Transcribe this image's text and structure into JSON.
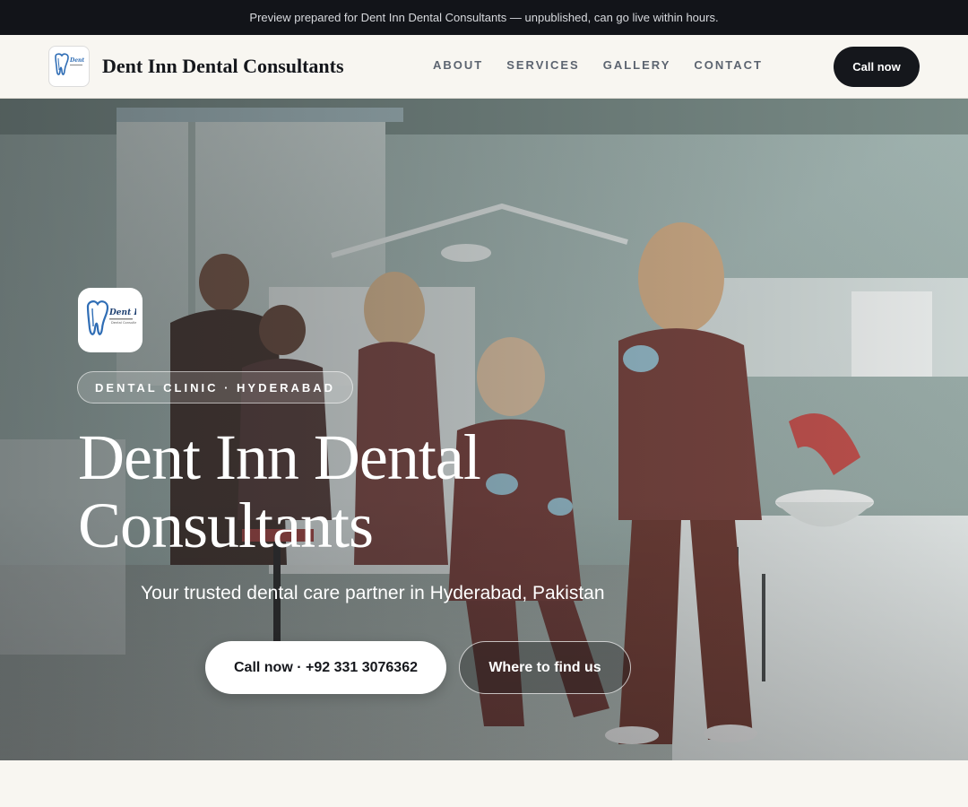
{
  "preview_bar": {
    "text": "Preview prepared for Dent Inn Dental Consultants — unpublished, can go live within hours."
  },
  "header": {
    "logo_icon": "tooth-logo-icon",
    "brand_name": "Dent Inn Dental Consultants",
    "nav": [
      "ABOUT",
      "SERVICES",
      "GALLERY",
      "CONTACT"
    ],
    "cta_label": "Call now"
  },
  "hero": {
    "logo_icon": "tooth-logo-icon",
    "badge": "DENTAL CLINIC · HYDERABAD",
    "title": "Dent Inn Dental Consultants",
    "subtitle": "Your trusted dental care partner in Hyderabad, Pakistan",
    "primary_button": "Call now · +92 331 3076362",
    "secondary_button": "Where to find us",
    "photo": "dental-clinic-staff-photo"
  },
  "colors": {
    "dark": "#15171c",
    "page_bg": "#f8f6f1",
    "logo_blue": "#2f6db5"
  }
}
